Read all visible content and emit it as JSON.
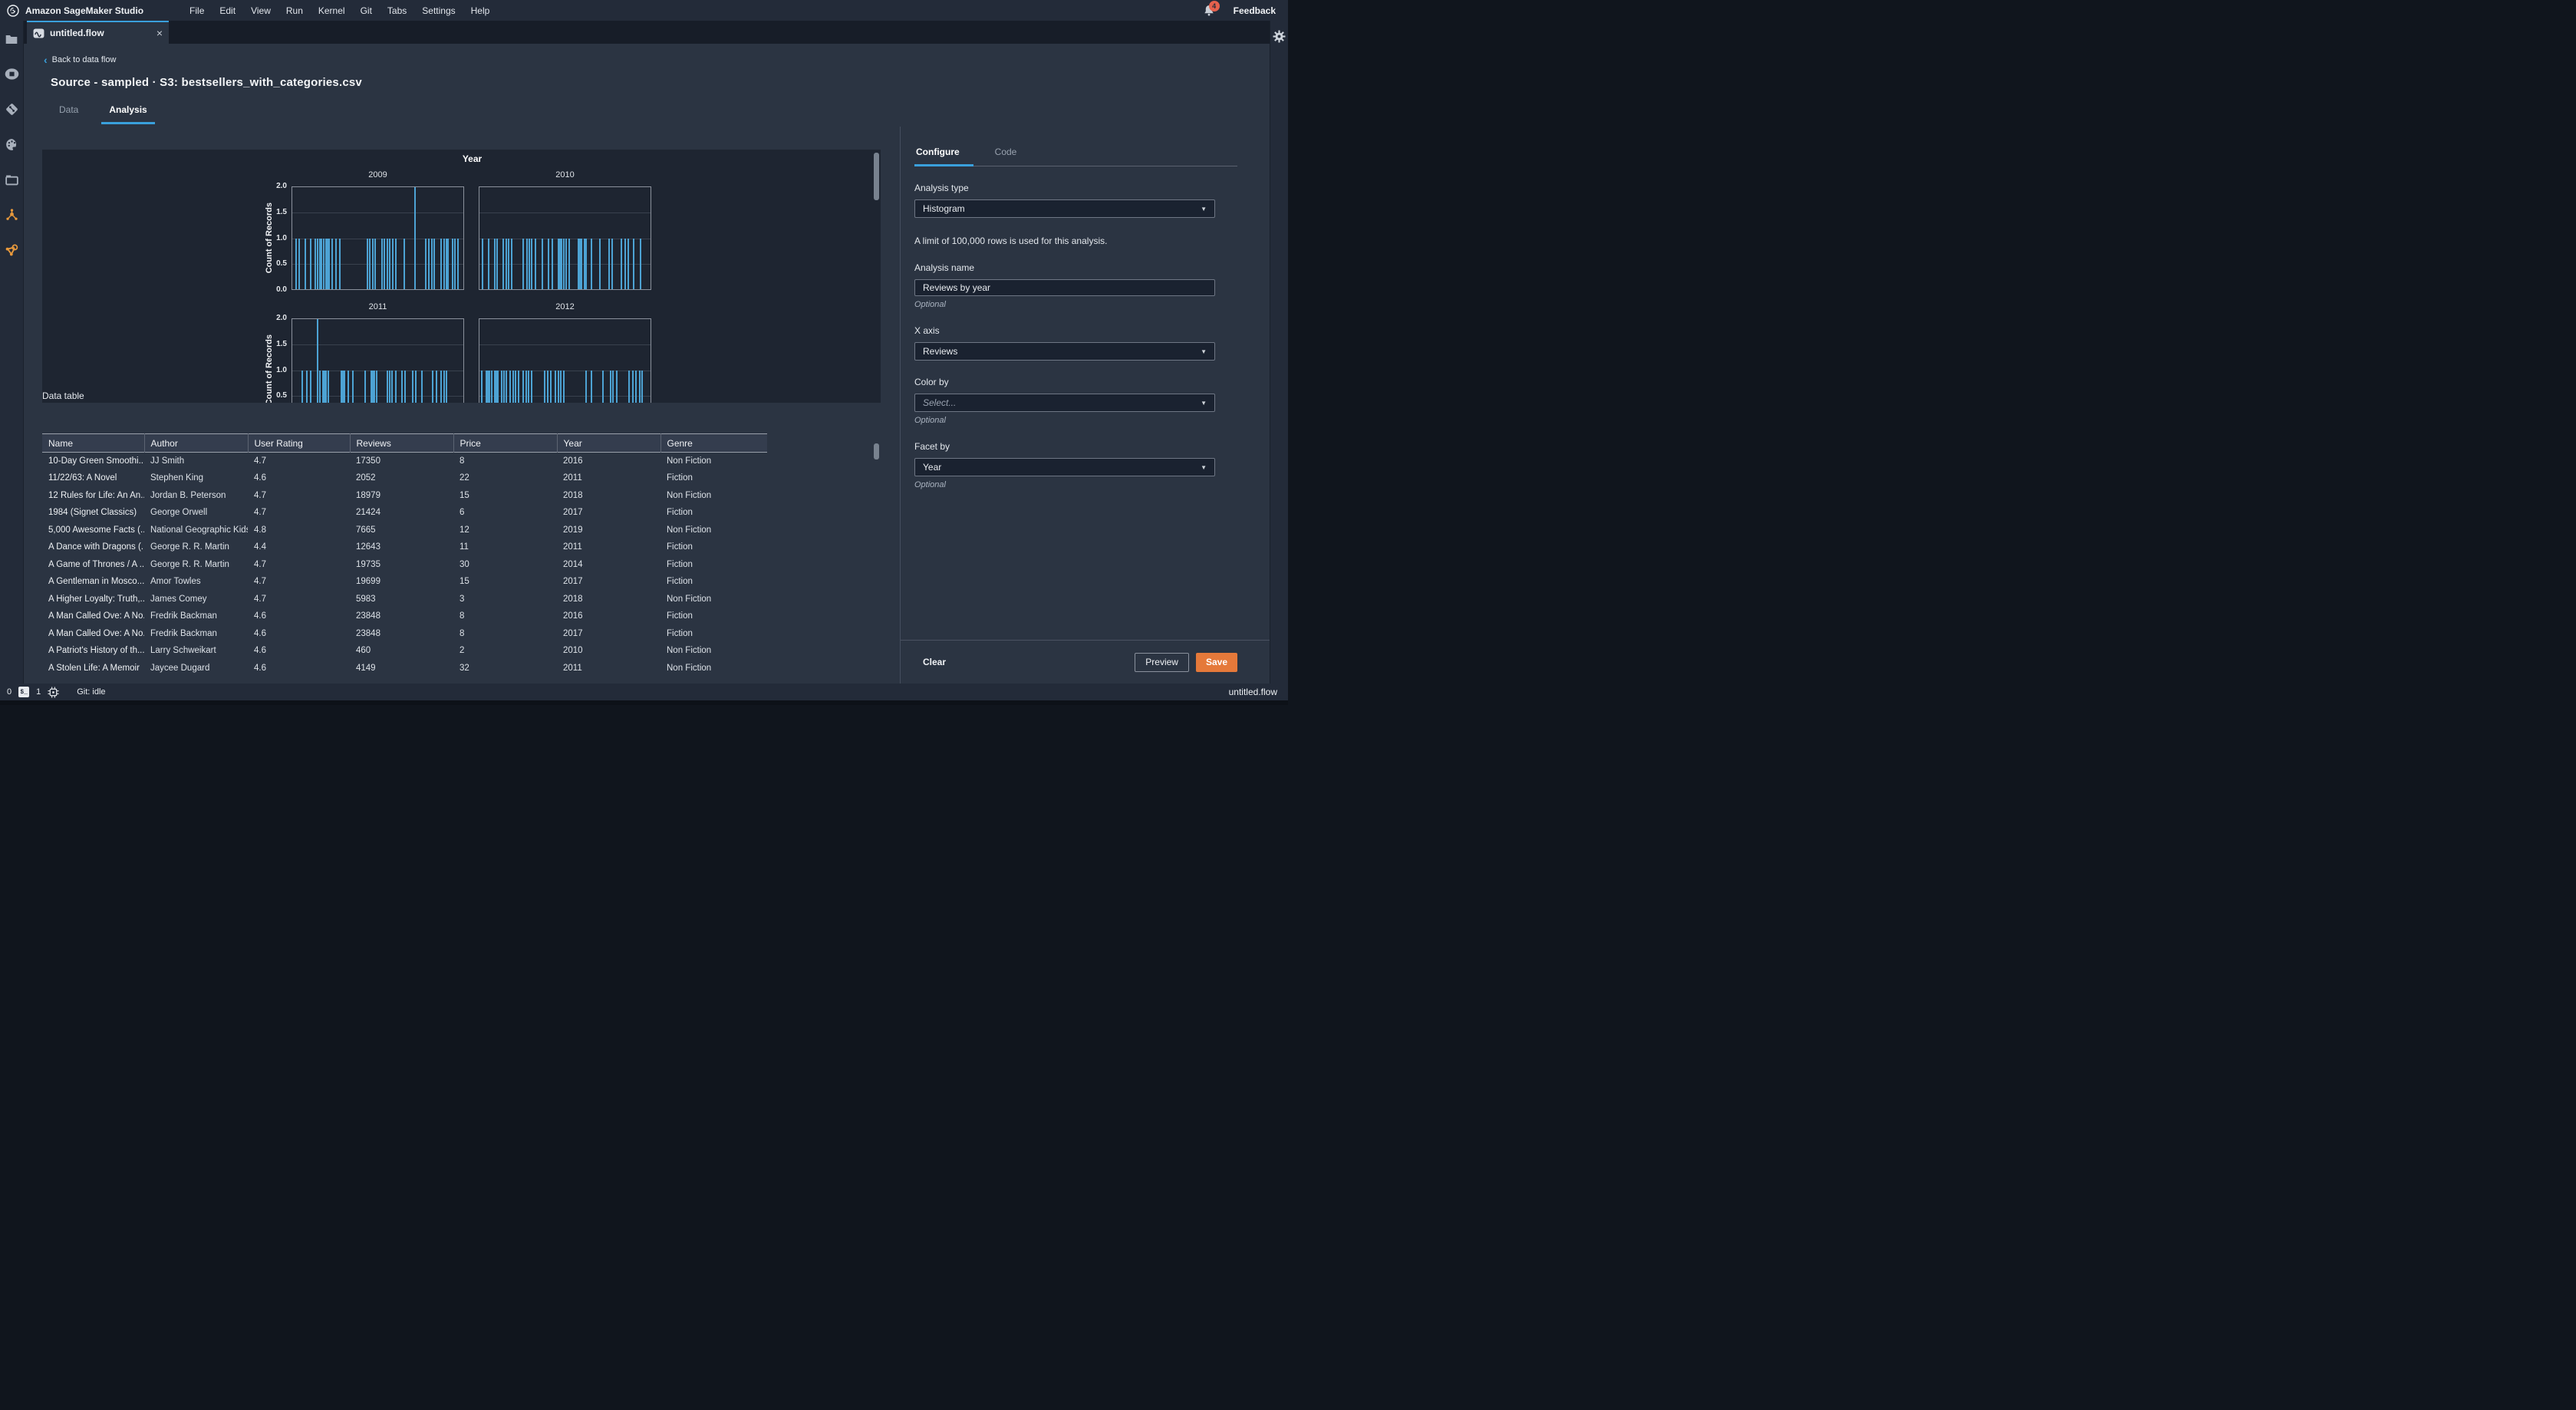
{
  "menubar": {
    "app_title": "Amazon SageMaker Studio",
    "items": [
      "File",
      "Edit",
      "View",
      "Run",
      "Kernel",
      "Git",
      "Tabs",
      "Settings",
      "Help"
    ],
    "notification_count": "4",
    "feedback_label": "Feedback"
  },
  "sidebar_icons": [
    "file-browser-icon",
    "running-kernels-icon",
    "git-icon",
    "commands-palette-icon",
    "open-tabs-icon",
    "experiments-cluster-icon",
    "pipeline-graph-icon"
  ],
  "tabbar": {
    "tab_label": "untitled.flow",
    "tab_icon": "flow-icon",
    "close_icon": "close-icon"
  },
  "page": {
    "back_link": "Back to data flow",
    "title": "Source - sampled · S3: bestsellers_with_categories.csv",
    "tabs": [
      {
        "label": "Data"
      },
      {
        "label": "Analysis"
      }
    ]
  },
  "chart_data": {
    "type": "bar",
    "subtype": "faceted-histogram",
    "title": "Year",
    "ylabel": "Count of Records",
    "xlabel": "",
    "ylim": [
      0,
      2
    ],
    "yticks_desc": [
      "2.0",
      "1.5",
      "1.0",
      "0.5",
      "0.0"
    ],
    "grid": true,
    "facets": [
      {
        "label": "2009",
        "bars": [
          [
            0.012,
            1
          ],
          [
            0.03,
            1
          ],
          [
            0.07,
            1
          ],
          [
            0.1,
            1
          ],
          [
            0.125,
            1
          ],
          [
            0.14,
            1
          ],
          [
            0.155,
            1
          ],
          [
            0.165,
            1
          ],
          [
            0.175,
            1
          ],
          [
            0.19,
            1
          ],
          [
            0.2,
            1
          ],
          [
            0.21,
            1
          ],
          [
            0.225,
            1
          ],
          [
            0.25,
            1
          ],
          [
            0.27,
            1
          ],
          [
            0.435,
            1
          ],
          [
            0.45,
            1
          ],
          [
            0.465,
            1
          ],
          [
            0.48,
            1
          ],
          [
            0.52,
            1
          ],
          [
            0.535,
            1
          ],
          [
            0.55,
            1
          ],
          [
            0.565,
            1
          ],
          [
            0.585,
            1
          ],
          [
            0.6,
            1
          ],
          [
            0.65,
            1
          ],
          [
            0.715,
            2
          ],
          [
            0.78,
            1
          ],
          [
            0.795,
            1
          ],
          [
            0.815,
            1
          ],
          [
            0.83,
            1
          ],
          [
            0.87,
            1
          ],
          [
            0.885,
            1
          ],
          [
            0.9,
            1
          ],
          [
            0.91,
            1
          ],
          [
            0.935,
            1
          ],
          [
            0.95,
            1
          ],
          [
            0.97,
            1
          ]
        ]
      },
      {
        "label": "2010",
        "bars": [
          [
            0.01,
            1
          ],
          [
            0.045,
            1
          ],
          [
            0.08,
            1
          ],
          [
            0.095,
            1
          ],
          [
            0.13,
            1
          ],
          [
            0.15,
            1
          ],
          [
            0.165,
            1
          ],
          [
            0.18,
            1
          ],
          [
            0.25,
            1
          ],
          [
            0.27,
            1
          ],
          [
            0.285,
            1
          ],
          [
            0.3,
            1
          ],
          [
            0.32,
            1
          ],
          [
            0.36,
            1
          ],
          [
            0.4,
            1
          ],
          [
            0.42,
            1
          ],
          [
            0.455,
            1
          ],
          [
            0.465,
            1
          ],
          [
            0.475,
            1
          ],
          [
            0.49,
            1
          ],
          [
            0.5,
            1
          ],
          [
            0.52,
            1
          ],
          [
            0.575,
            1
          ],
          [
            0.585,
            1
          ],
          [
            0.595,
            1
          ],
          [
            0.61,
            1
          ],
          [
            0.62,
            1
          ],
          [
            0.65,
            1
          ],
          [
            0.7,
            1
          ],
          [
            0.755,
            1
          ],
          [
            0.775,
            1
          ],
          [
            0.83,
            1
          ],
          [
            0.85,
            1
          ],
          [
            0.87,
            1
          ],
          [
            0.9,
            1
          ],
          [
            0.94,
            1
          ]
        ]
      },
      {
        "label": "2011",
        "bars": [
          [
            0.05,
            1
          ],
          [
            0.075,
            1
          ],
          [
            0.1,
            1
          ],
          [
            0.14,
            2
          ],
          [
            0.155,
            1
          ],
          [
            0.17,
            1
          ],
          [
            0.18,
            1
          ],
          [
            0.19,
            1
          ],
          [
            0.205,
            1
          ],
          [
            0.28,
            1
          ],
          [
            0.29,
            1
          ],
          [
            0.3,
            1
          ],
          [
            0.32,
            1
          ],
          [
            0.35,
            1
          ],
          [
            0.42,
            1
          ],
          [
            0.455,
            1
          ],
          [
            0.465,
            1
          ],
          [
            0.475,
            1
          ],
          [
            0.49,
            1
          ],
          [
            0.55,
            1
          ],
          [
            0.565,
            1
          ],
          [
            0.58,
            1
          ],
          [
            0.6,
            1
          ],
          [
            0.64,
            1
          ],
          [
            0.655,
            1
          ],
          [
            0.7,
            1
          ],
          [
            0.72,
            1
          ],
          [
            0.755,
            1
          ],
          [
            0.82,
            1
          ],
          [
            0.84,
            1
          ],
          [
            0.87,
            1
          ],
          [
            0.885,
            1
          ],
          [
            0.9,
            1
          ]
        ]
      },
      {
        "label": "2012",
        "bars": [
          [
            0.005,
            1
          ],
          [
            0.03,
            1
          ],
          [
            0.04,
            1
          ],
          [
            0.05,
            1
          ],
          [
            0.065,
            1
          ],
          [
            0.08,
            1
          ],
          [
            0.09,
            1
          ],
          [
            0.1,
            1
          ],
          [
            0.12,
            1
          ],
          [
            0.135,
            1
          ],
          [
            0.15,
            1
          ],
          [
            0.17,
            1
          ],
          [
            0.19,
            1
          ],
          [
            0.205,
            1
          ],
          [
            0.22,
            1
          ],
          [
            0.25,
            1
          ],
          [
            0.265,
            1
          ],
          [
            0.28,
            1
          ],
          [
            0.3,
            1
          ],
          [
            0.375,
            1
          ],
          [
            0.395,
            1
          ],
          [
            0.41,
            1
          ],
          [
            0.44,
            1
          ],
          [
            0.455,
            1
          ],
          [
            0.47,
            1
          ],
          [
            0.49,
            1
          ],
          [
            0.62,
            1
          ],
          [
            0.65,
            1
          ],
          [
            0.72,
            1
          ],
          [
            0.765,
            1
          ],
          [
            0.78,
            1
          ],
          [
            0.8,
            1
          ],
          [
            0.875,
            1
          ],
          [
            0.895,
            1
          ],
          [
            0.915,
            1
          ],
          [
            0.935,
            1
          ],
          [
            0.95,
            1
          ]
        ]
      }
    ]
  },
  "data_table": {
    "section_label": "Data table",
    "columns": [
      "Name",
      "Author",
      "User Rating",
      "Reviews",
      "Price",
      "Year",
      "Genre"
    ],
    "rows": [
      [
        "10-Day Green Smoothi...",
        "JJ Smith",
        "4.7",
        "17350",
        "8",
        "2016",
        "Non Fiction"
      ],
      [
        "11/22/63: A Novel",
        "Stephen King",
        "4.6",
        "2052",
        "22",
        "2011",
        "Fiction"
      ],
      [
        "12 Rules for Life: An An...",
        "Jordan B. Peterson",
        "4.7",
        "18979",
        "15",
        "2018",
        "Non Fiction"
      ],
      [
        "1984 (Signet Classics)",
        "George Orwell",
        "4.7",
        "21424",
        "6",
        "2017",
        "Fiction"
      ],
      [
        "5,000 Awesome Facts (...",
        "National Geographic Kids",
        "4.8",
        "7665",
        "12",
        "2019",
        "Non Fiction"
      ],
      [
        "A Dance with Dragons (...",
        "George R. R. Martin",
        "4.4",
        "12643",
        "11",
        "2011",
        "Fiction"
      ],
      [
        "A Game of Thrones / A ...",
        "George R. R. Martin",
        "4.7",
        "19735",
        "30",
        "2014",
        "Fiction"
      ],
      [
        "A Gentleman in Mosco...",
        "Amor Towles",
        "4.7",
        "19699",
        "15",
        "2017",
        "Fiction"
      ],
      [
        "A Higher Loyalty: Truth,...",
        "James Comey",
        "4.7",
        "5983",
        "3",
        "2018",
        "Non Fiction"
      ],
      [
        "A Man Called Ove: A No...",
        "Fredrik Backman",
        "4.6",
        "23848",
        "8",
        "2016",
        "Fiction"
      ],
      [
        "A Man Called Ove: A No...",
        "Fredrik Backman",
        "4.6",
        "23848",
        "8",
        "2017",
        "Fiction"
      ],
      [
        "A Patriot's History of th...",
        "Larry Schweikart",
        "4.6",
        "460",
        "2",
        "2010",
        "Non Fiction"
      ],
      [
        "A Stolen Life: A Memoir",
        "Jaycee Dugard",
        "4.6",
        "4149",
        "32",
        "2011",
        "Non Fiction"
      ]
    ]
  },
  "config_panel": {
    "tabs": [
      "Configure",
      "Code"
    ],
    "analysis_type_label": "Analysis type",
    "analysis_type_value": "Histogram",
    "limit_note": "A limit of 100,000 rows is used for this analysis.",
    "analysis_name_label": "Analysis name",
    "analysis_name_value": "Reviews by year",
    "optional_label": "Optional",
    "x_axis_label": "X axis",
    "x_axis_value": "Reviews",
    "color_by_label": "Color by",
    "color_by_placeholder": "Select...",
    "facet_by_label": "Facet by",
    "facet_by_value": "Year",
    "clear_label": "Clear",
    "preview_label": "Preview",
    "save_label": "Save"
  },
  "statusbar": {
    "terminal_count": "0",
    "kernel_count": "1",
    "git_status": "Git: idle",
    "file_label": "untitled.flow"
  },
  "colors": {
    "accent_blue": "#3aa0dc",
    "bar_blue": "#4da3d4",
    "save_orange": "#e5793a",
    "badge_red": "#e4614d"
  }
}
